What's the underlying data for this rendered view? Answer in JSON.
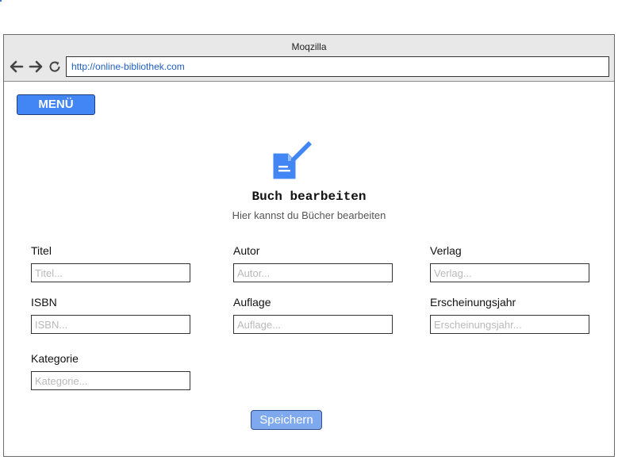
{
  "browser": {
    "title": "Moqzilla",
    "url": "http://online-bibliothek.com",
    "icons": [
      "back-arrow-icon",
      "forward-arrow-icon",
      "reload-icon"
    ]
  },
  "menu": {
    "label": "MENÜ"
  },
  "page": {
    "icon": "edit-document-icon",
    "title": "Buch bearbeiten",
    "subtitle": "Hier kannst du Bücher bearbeiten"
  },
  "form": {
    "titel": {
      "label": "Titel",
      "placeholder": "Titel..."
    },
    "autor": {
      "label": "Autor",
      "placeholder": "Autor..."
    },
    "verlag": {
      "label": "Verlag",
      "placeholder": "Verlag..."
    },
    "isbn": {
      "label": "ISBN",
      "placeholder": "ISBN..."
    },
    "auflage": {
      "label": "Auflage",
      "placeholder": "Auflage..."
    },
    "jahr": {
      "label": "Erscheinungsjahr",
      "placeholder": "Erscheinungsjahr..."
    },
    "kategorie": {
      "label": "Kategorie",
      "placeholder": "Kategorie..."
    },
    "save_label": "Speichern"
  },
  "colors": {
    "accent": "#4285f4",
    "save_button": "#7ea9ee",
    "url_text": "#1f5fbf"
  }
}
